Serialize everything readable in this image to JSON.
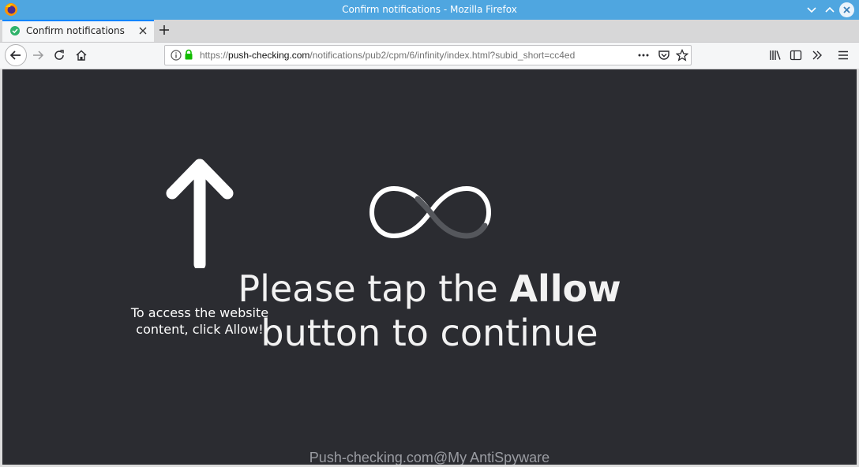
{
  "window": {
    "title": "Confirm notifications - Mozilla Firefox"
  },
  "tabs": [
    {
      "label": "Confirm notifications",
      "active": true
    }
  ],
  "urlbar": {
    "scheme": "https://",
    "host": "push-checking.com",
    "path": "/notifications/pub2/cpm/6/infinity/index.html?subid_short=cc4ed"
  },
  "content": {
    "headline_part1": "Please tap the ",
    "headline_bold": "Allow",
    "headline_line2": "button to continue",
    "side_note_line1": "To access the website",
    "side_note_line2": "content, click Allow!",
    "watermark": "Push-checking.com@My AntiSpyware"
  },
  "colors": {
    "titlebar": "#4fa6e0",
    "page_background": "#2b2c31",
    "tab_accent": "#0a84ff"
  },
  "icons": {
    "app": "firefox-logo",
    "arrow": "arrow-up",
    "loader": "infinity"
  }
}
